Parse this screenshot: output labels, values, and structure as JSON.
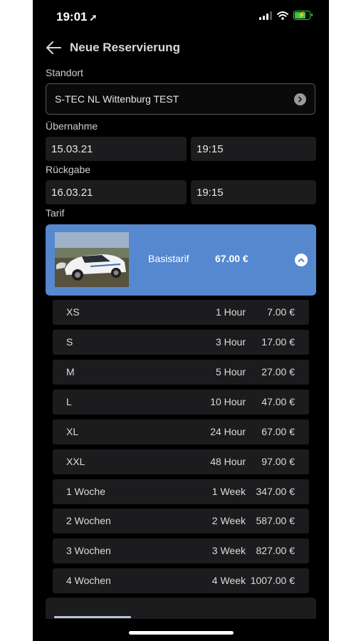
{
  "status_bar": {
    "time": "19:01"
  },
  "header": {
    "title": "Neue Reservierung"
  },
  "standort": {
    "label": "Standort",
    "value": "S-TEC NL Wittenburg TEST"
  },
  "uebernahme": {
    "label": "Übernahme",
    "date": "15.03.21",
    "time": "19:15"
  },
  "rueckgabe": {
    "label": "Rückgabe",
    "date": "16.03.21",
    "time": "19:15"
  },
  "tarif": {
    "label": "Tarif",
    "name": "Basistarif",
    "price": "67.00 €"
  },
  "tariff_options": [
    {
      "name": "XS",
      "duration": "1 Hour",
      "price": "7.00 €"
    },
    {
      "name": "S",
      "duration": "3 Hour",
      "price": "17.00 €"
    },
    {
      "name": "M",
      "duration": "5 Hour",
      "price": "27.00 €"
    },
    {
      "name": "L",
      "duration": "10 Hour",
      "price": "47.00 €"
    },
    {
      "name": "XL",
      "duration": "24 Hour",
      "price": "67.00 €"
    },
    {
      "name": "XXL",
      "duration": "48 Hour",
      "price": "97.00 €"
    },
    {
      "name": "1 Woche",
      "duration": "1 Week",
      "price": "347.00 €"
    },
    {
      "name": "2 Wochen",
      "duration": "2 Week",
      "price": "587.00 €"
    },
    {
      "name": "3 Wochen",
      "duration": "3 Week",
      "price": "827.00 €"
    },
    {
      "name": "4 Wochen",
      "duration": "4 Week",
      "price": "1007.00 €"
    }
  ],
  "colors": {
    "accent": "#5588cf",
    "background": "#000000",
    "field": "#1c1c1e"
  }
}
